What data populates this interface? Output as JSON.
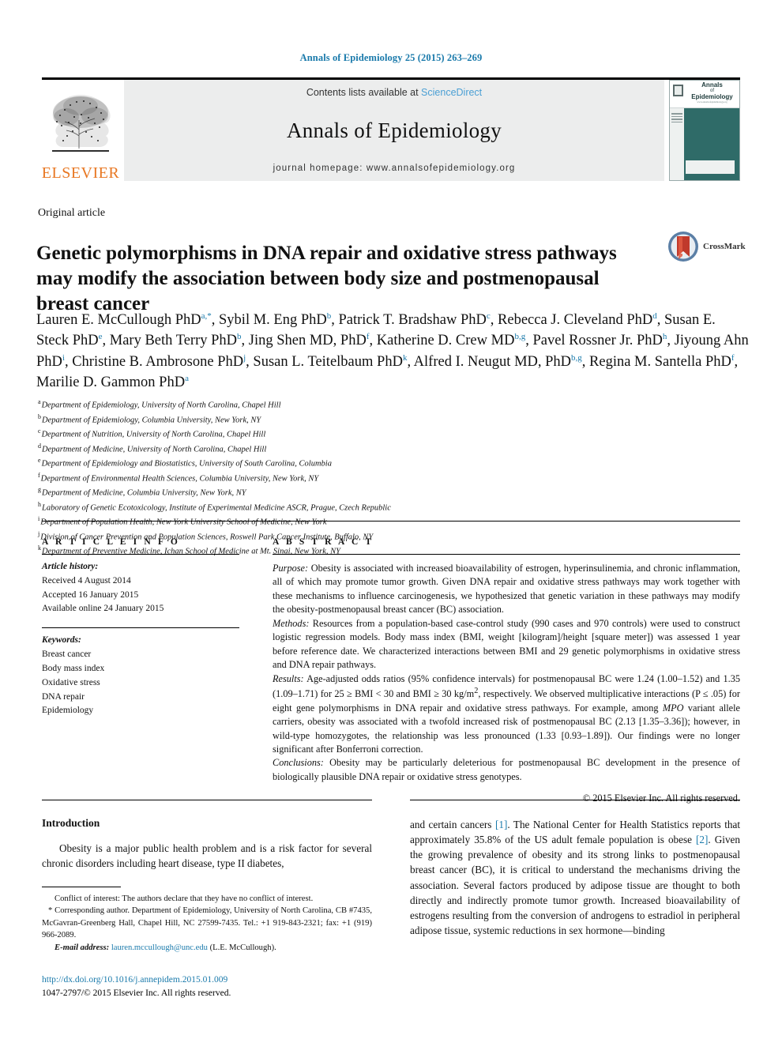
{
  "running_head": "Annals of Epidemiology 25 (2015) 263–269",
  "masthead": {
    "publisher": "ELSEVIER",
    "contents_prefix": "Contents lists available at ",
    "contents_link": "ScienceDirect",
    "journal_name": "Annals of Epidemiology",
    "homepage": "journal homepage: www.annalsofepidemiology.org",
    "cover": {
      "line1": "Annals",
      "line2": "of",
      "line3": "Epidemiology",
      "line4": "www.annalsofepidemiology.org"
    }
  },
  "article": {
    "type": "Original article",
    "title": "Genetic polymorphisms in DNA repair and oxidative stress pathways may modify the association between body size and postmenopausal breast cancer",
    "crossmark_label": "CrossMark"
  },
  "authors_html": "Lauren E. McCullough PhD<sup>a,*</sup>, Sybil M. Eng PhD<sup>b</sup>, Patrick T. Bradshaw PhD<sup>c</sup>, Rebecca J. Cleveland PhD<sup>d</sup>, Susan E. Steck PhD<sup>e</sup>, Mary Beth Terry PhD<sup>b</sup>, Jing Shen MD, PhD<sup>f</sup>, Katherine D. Crew MD<sup>b,g</sup>, Pavel Rossner Jr. PhD<sup>h</sup>, Jiyoung Ahn PhD<sup>i</sup>, Christine B. Ambrosone PhD<sup>j</sup>, Susan L. Teitelbaum PhD<sup>k</sup>, Alfred I. Neugut MD, PhD<sup>b,g</sup>, Regina M. Santella PhD<sup>f</sup>, Marilie D. Gammon PhD<sup>a</sup>",
  "affiliations": [
    {
      "mark": "a",
      "text": "Department of Epidemiology, University of North Carolina, Chapel Hill"
    },
    {
      "mark": "b",
      "text": "Department of Epidemiology, Columbia University, New York, NY"
    },
    {
      "mark": "c",
      "text": "Department of Nutrition, University of North Carolina, Chapel Hill"
    },
    {
      "mark": "d",
      "text": "Department of Medicine, University of North Carolina, Chapel Hill"
    },
    {
      "mark": "e",
      "text": "Department of Epidemiology and Biostatistics, University of South Carolina, Columbia"
    },
    {
      "mark": "f",
      "text": "Department of Environmental Health Sciences, Columbia University, New York, NY"
    },
    {
      "mark": "g",
      "text": "Department of Medicine, Columbia University, New York, NY"
    },
    {
      "mark": "h",
      "text": "Laboratory of Genetic Ecotoxicology, Institute of Experimental Medicine ASCR, Prague, Czech Republic"
    },
    {
      "mark": "i",
      "text": "Department of Population Health, New York University School of Medicine, New York"
    },
    {
      "mark": "j",
      "text": "Division of Cancer Prevention and Population Sciences, Roswell Park Cancer Institute, Buffalo, NY"
    },
    {
      "mark": "k",
      "text": "Department of Preventive Medicine, Ichan School of Medicine at Mt. Sinai, New York, NY"
    }
  ],
  "article_info": {
    "heading": "A R T I C L E  I N F O",
    "history_label": "Article history:",
    "history": [
      "Received 4 August 2014",
      "Accepted 16 January 2015",
      "Available online 24 January 2015"
    ],
    "keywords_label": "Keywords:",
    "keywords": [
      "Breast cancer",
      "Body mass index",
      "Oxidative stress",
      "DNA repair",
      "Epidemiology"
    ]
  },
  "abstract": {
    "heading": "A B S T R A C T",
    "purpose_label": "Purpose:",
    "purpose_text": " Obesity is associated with increased bioavailability of estrogen, hyperinsulinemia, and chronic inflammation, all of which may promote tumor growth. Given DNA repair and oxidative stress pathways may work together with these mechanisms to influence carcinogenesis, we hypothesized that genetic variation in these pathways may modify the obesity-postmenopausal breast cancer (BC) association.",
    "methods_label": "Methods:",
    "methods_text": " Resources from a population-based case-control study (990 cases and 970 controls) were used to construct logistic regression models. Body mass index (BMI, weight [kilogram]/height [square meter]) was assessed 1 year before reference date. We characterized interactions between BMI and 29 genetic polymorphisms in oxidative stress and DNA repair pathways.",
    "results_label": "Results:",
    "results_text_1": " Age-adjusted odds ratios (95% confidence intervals) for postmenopausal BC were 1.24 (1.00–1.52) and 1.35 (1.09–1.71) for 25 ≥ BMI < 30 and BMI ≥ 30 kg/m",
    "results_sup": "2",
    "results_text_2": ", respectively. We observed multiplicative interactions (P ≤ .05) for eight gene polymorphisms in DNA repair and oxidative stress pathways. For example, among ",
    "results_gene": "MPO",
    "results_text_3": " variant allele carriers, obesity was associated with a twofold increased risk of postmenopausal BC (2.13 [1.35–3.36]); however, in wild-type homozygotes, the relationship was less pronounced (1.33 [0.93–1.89]). Our findings were no longer significant after Bonferroni correction.",
    "conclusions_label": "Conclusions:",
    "conclusions_text": " Obesity may be particularly deleterious for postmenopausal BC development in the presence of biologically plausible DNA repair or oxidative stress genotypes.",
    "copyright": "© 2015 Elsevier Inc. All rights reserved."
  },
  "introduction": {
    "heading": "Introduction",
    "left_paragraph": "Obesity is a major public health problem and is a risk factor for several chronic disorders including heart disease, type II diabetes,",
    "right_parts": {
      "p1": "and certain cancers ",
      "ref1": "[1]",
      "p2": ". The National Center for Health Statistics reports that approximately 35.8% of the US adult female population is obese ",
      "ref2": "[2]",
      "p3": ". Given the growing prevalence of obesity and its strong links to postmenopausal breast cancer (BC), it is critical to understand the mechanisms driving the association. Several factors produced by adipose tissue are thought to both directly and indirectly promote tumor growth. Increased bioavailability of estrogens resulting from the conversion of androgens to estradiol in peripheral adipose tissue, systemic reductions in sex hormone—binding"
    }
  },
  "footnotes": {
    "conflict": "Conflict of interest: The authors declare that they have no conflict of interest.",
    "corresponding": "* Corresponding author. Department of Epidemiology, University of North Carolina, CB #7435, McGavran-Greenberg Hall, Chapel Hill, NC 27599-7435. Tel.: +1 919-843-2321; fax: +1 (919) 966-2089.",
    "email_label": "E-mail address:",
    "email": "lauren.mccullough@unc.edu",
    "email_suffix": " (L.E. McCullough).",
    "doi": "http://dx.doi.org/10.1016/j.annepidem.2015.01.009",
    "issn_line": "1047-2797/© 2015 Elsevier Inc. All rights reserved."
  },
  "colors": {
    "link_blue": "#1a7aab",
    "sciencedirect_blue": "#4a9fd4",
    "elsevier_orange": "#e87722",
    "cover_teal": "#2f6b68",
    "masthead_grey": "#eceded"
  }
}
